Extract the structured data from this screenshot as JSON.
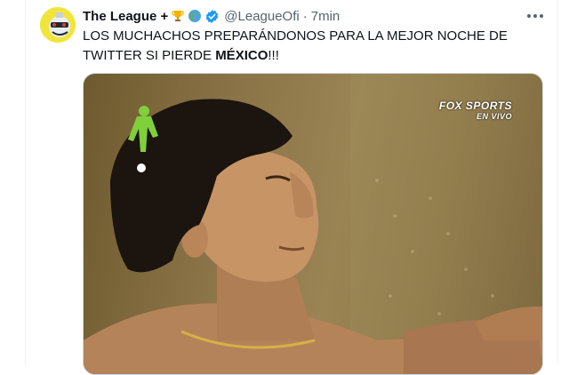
{
  "tweet": {
    "author": {
      "display_name": "The League +",
      "name_emojis": [
        "trophy-icon",
        "globe-icon"
      ],
      "verified_icon": "verified-badge-icon",
      "handle": "@LeagueOfi",
      "separator": "·",
      "time": "7min"
    },
    "text_line1": "LOS MUCHACHOS PREPARÁNDONOS PARA LA MEJOR NOCHE DE",
    "text_line2_prefix": "TWITTER SI PIERDE ",
    "text_bold": "MÉXICO",
    "text_suffix": "!!!",
    "more_icon": "more-options-icon",
    "media": {
      "watermark_main": "FOX SPORTS",
      "watermark_sub": "EN VIVO"
    }
  },
  "colors": {
    "primary_text": "#0f1419",
    "secondary_text": "#536471",
    "verified": "#1d9bf0",
    "border": "#eff3f4"
  }
}
